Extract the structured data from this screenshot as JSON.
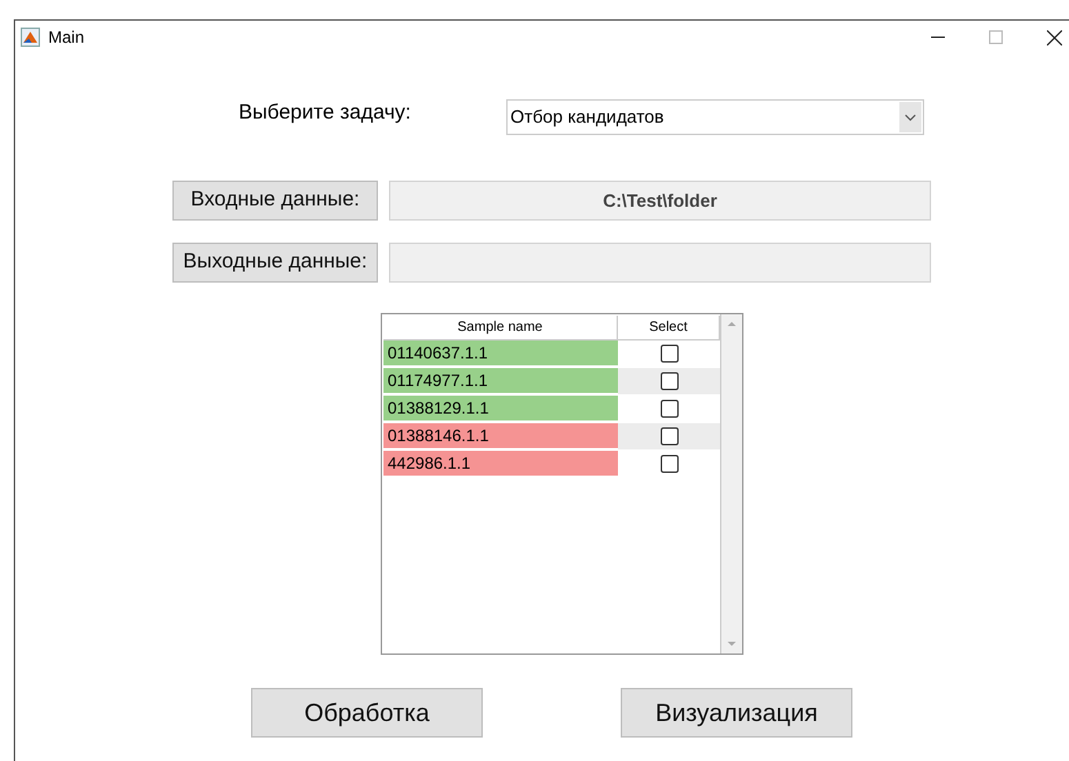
{
  "window": {
    "title": "Main"
  },
  "task": {
    "label": "Выберите задачу:",
    "value": "Отбор кандидатов"
  },
  "input": {
    "button": "Входные данные:",
    "value": "C:\\Test\\folder"
  },
  "output": {
    "button": "Выходные данные:"
  },
  "table": {
    "columns": [
      "Sample name",
      "Select"
    ],
    "rows": [
      {
        "name": "01140637.1.1",
        "color": "#98d08a",
        "checked": false
      },
      {
        "name": "01174977.1.1",
        "color": "#98d08a",
        "checked": false
      },
      {
        "name": "01388129.1.1",
        "color": "#98d08a",
        "checked": false
      },
      {
        "name": "01388146.1.1",
        "color": "#f59393",
        "checked": false
      },
      {
        "name": "442986.1.1",
        "color": "#f59393",
        "checked": false
      }
    ]
  },
  "buttons": [
    "Обработка",
    "Визуализация"
  ]
}
